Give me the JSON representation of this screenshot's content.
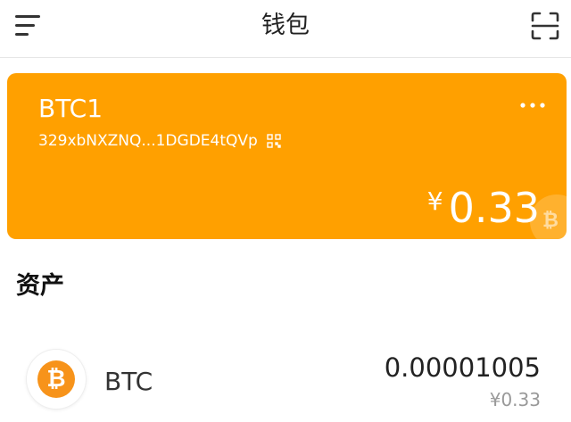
{
  "header": {
    "title": "钱包",
    "menu_icon": "menu-icon",
    "scan_icon": "scan-icon"
  },
  "wallet": {
    "name": "BTC1",
    "address": "329xbNXZNQ...1DGDE4tQVp",
    "currency_symbol": "¥",
    "balance": "0.33",
    "card_color": "#ffa000"
  },
  "assets": {
    "section_title": "资产",
    "items": [
      {
        "name": "BTC",
        "icon": "bitcoin-icon",
        "icon_glyph": "₿",
        "icon_color": "#f7931a",
        "amount": "0.00001005",
        "fiat_value": "¥0.33"
      }
    ]
  }
}
